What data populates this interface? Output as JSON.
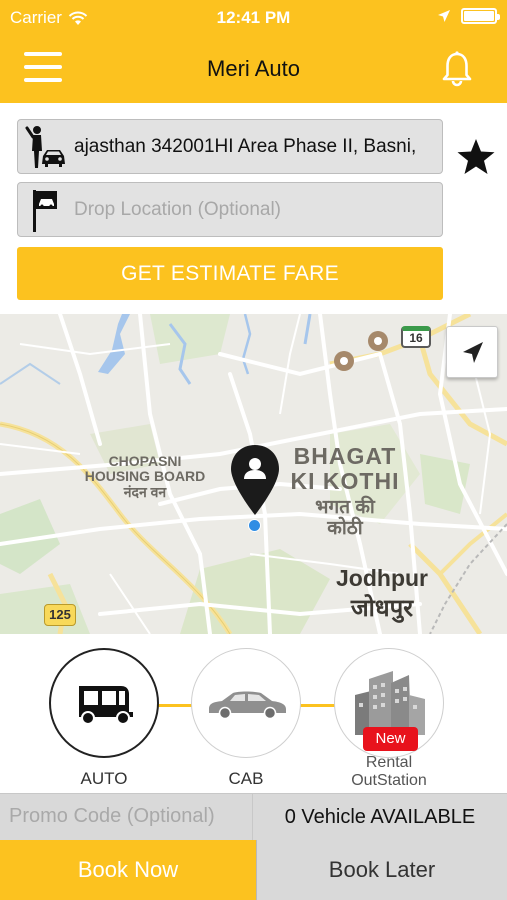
{
  "status_bar": {
    "carrier": "Carrier",
    "time": "12:41 PM",
    "battery_level": 1.0
  },
  "navbar": {
    "title": "Meri Auto",
    "menu_icon": "hamburger-menu-icon",
    "bell_icon": "bell-icon"
  },
  "pickup": {
    "value": "ajasthan 342001HI Area Phase II, Basni,",
    "icon": "person-with-car-icon"
  },
  "drop": {
    "placeholder": "Drop Location (Optional)",
    "value": "",
    "icon": "flag-car-icon"
  },
  "favorite_icon": "star-icon",
  "estimate_button": "GET ESTIMATE FARE",
  "map": {
    "labels": {
      "chopasni": "CHOPASNI\nHOUSING BOARD\nनंदन वन",
      "bhagat_en": "BHAGAT\nKI KOTHI",
      "bhagat_hi": "भगत की\nकोठी",
      "jodhpur_en": "Jodhpur",
      "jodhpur_hi": "जोधपुर",
      "shield_16": "16",
      "shield_125": "125"
    },
    "locate_icon": "navigation-arrow-icon"
  },
  "vehicles": [
    {
      "label": "AUTO",
      "icon": "auto-rickshaw-icon",
      "selected": true
    },
    {
      "label": "CAB",
      "icon": "car-icon",
      "selected": false
    },
    {
      "label": "Rental\nOutStation",
      "icon": "buildings-icon",
      "badge": "New",
      "selected": false
    }
  ],
  "promo": {
    "placeholder": "Promo Code (Optional)"
  },
  "availability": "0 Vehicle AVAILABLE",
  "book_now": "Book Now",
  "book_later": "Book Later",
  "colors": {
    "brand_yellow": "#fcc21f",
    "badge_red": "#e8121c",
    "map_marker": "#1b1b1b",
    "location_dot": "#2f8de4"
  }
}
